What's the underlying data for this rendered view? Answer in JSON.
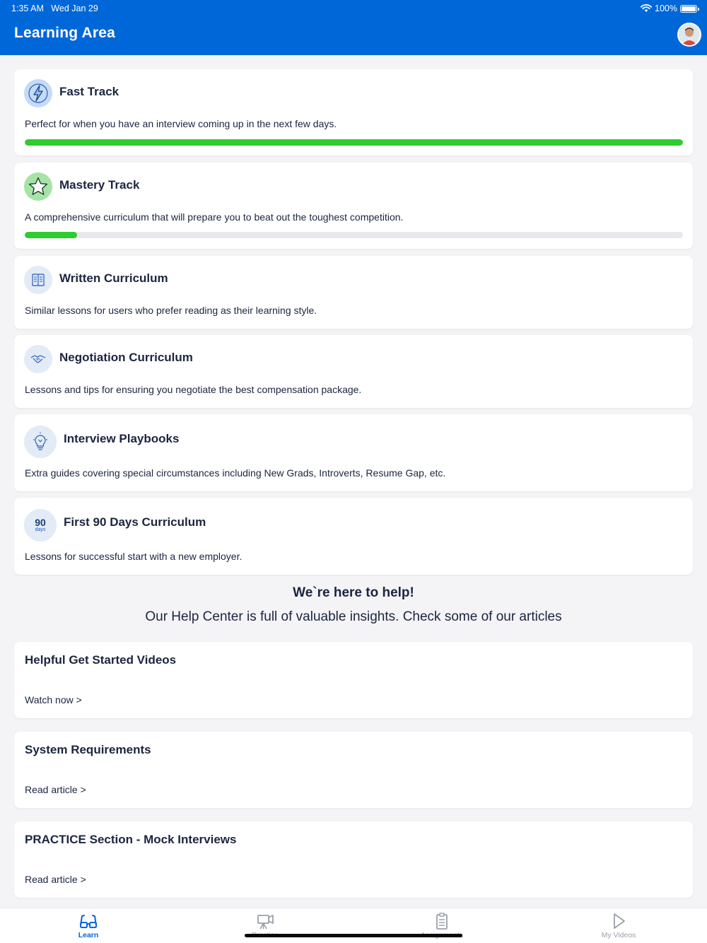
{
  "status_bar": {
    "time": "1:35 AM",
    "date": "Wed Jan 29",
    "battery": "100%"
  },
  "header": {
    "title": "Learning Area"
  },
  "tracks": [
    {
      "title": "Fast Track",
      "description": "Perfect for when you have an interview coming up in the next few days.",
      "icon": "lightning-icon",
      "progress": 1.0
    },
    {
      "title": "Mastery Track",
      "description": "A comprehensive curriculum that will prepare you to beat out the toughest competition.",
      "icon": "star-icon",
      "progress": 0.08
    },
    {
      "title": "Written Curriculum",
      "description": "Similar lessons for users who prefer reading as their learning style.",
      "icon": "book-icon"
    },
    {
      "title": "Negotiation Curriculum",
      "description": "Lessons and tips for ensuring you negotiate the best compensation package.",
      "icon": "handshake-icon"
    },
    {
      "title": "Interview Playbooks",
      "description": "Extra guides covering special circumstances including New Grads, Introverts, Resume Gap, etc.",
      "icon": "lightbulb-icon"
    },
    {
      "title": "First 90 Days Curriculum",
      "description": "Lessons for successful start with a new employer.",
      "icon": "calendar-90-icon",
      "icon_number": "90",
      "icon_unit": "days"
    }
  ],
  "help": {
    "heading": "We`re here to help!",
    "subheading": "Our Help Center is full of valuable insights. Check some of our articles"
  },
  "articles": [
    {
      "title": "Helpful Get Started Videos",
      "link": "Watch now >"
    },
    {
      "title": "System Requirements",
      "link": "Read article >"
    },
    {
      "title": "PRACTICE Section - Mock Interviews",
      "link": "Read article >"
    }
  ],
  "tabs": [
    {
      "label": "Learn",
      "icon": "glasses-icon",
      "active": true
    },
    {
      "label": "Practice",
      "icon": "camera-icon",
      "active": false
    },
    {
      "label": "Assignments",
      "icon": "clipboard-icon",
      "active": false
    },
    {
      "label": "My Videos",
      "icon": "play-icon",
      "active": false
    }
  ],
  "colors": {
    "brand": "#0067d9",
    "progress": "#2ecc2e",
    "text": "#1b2540"
  }
}
